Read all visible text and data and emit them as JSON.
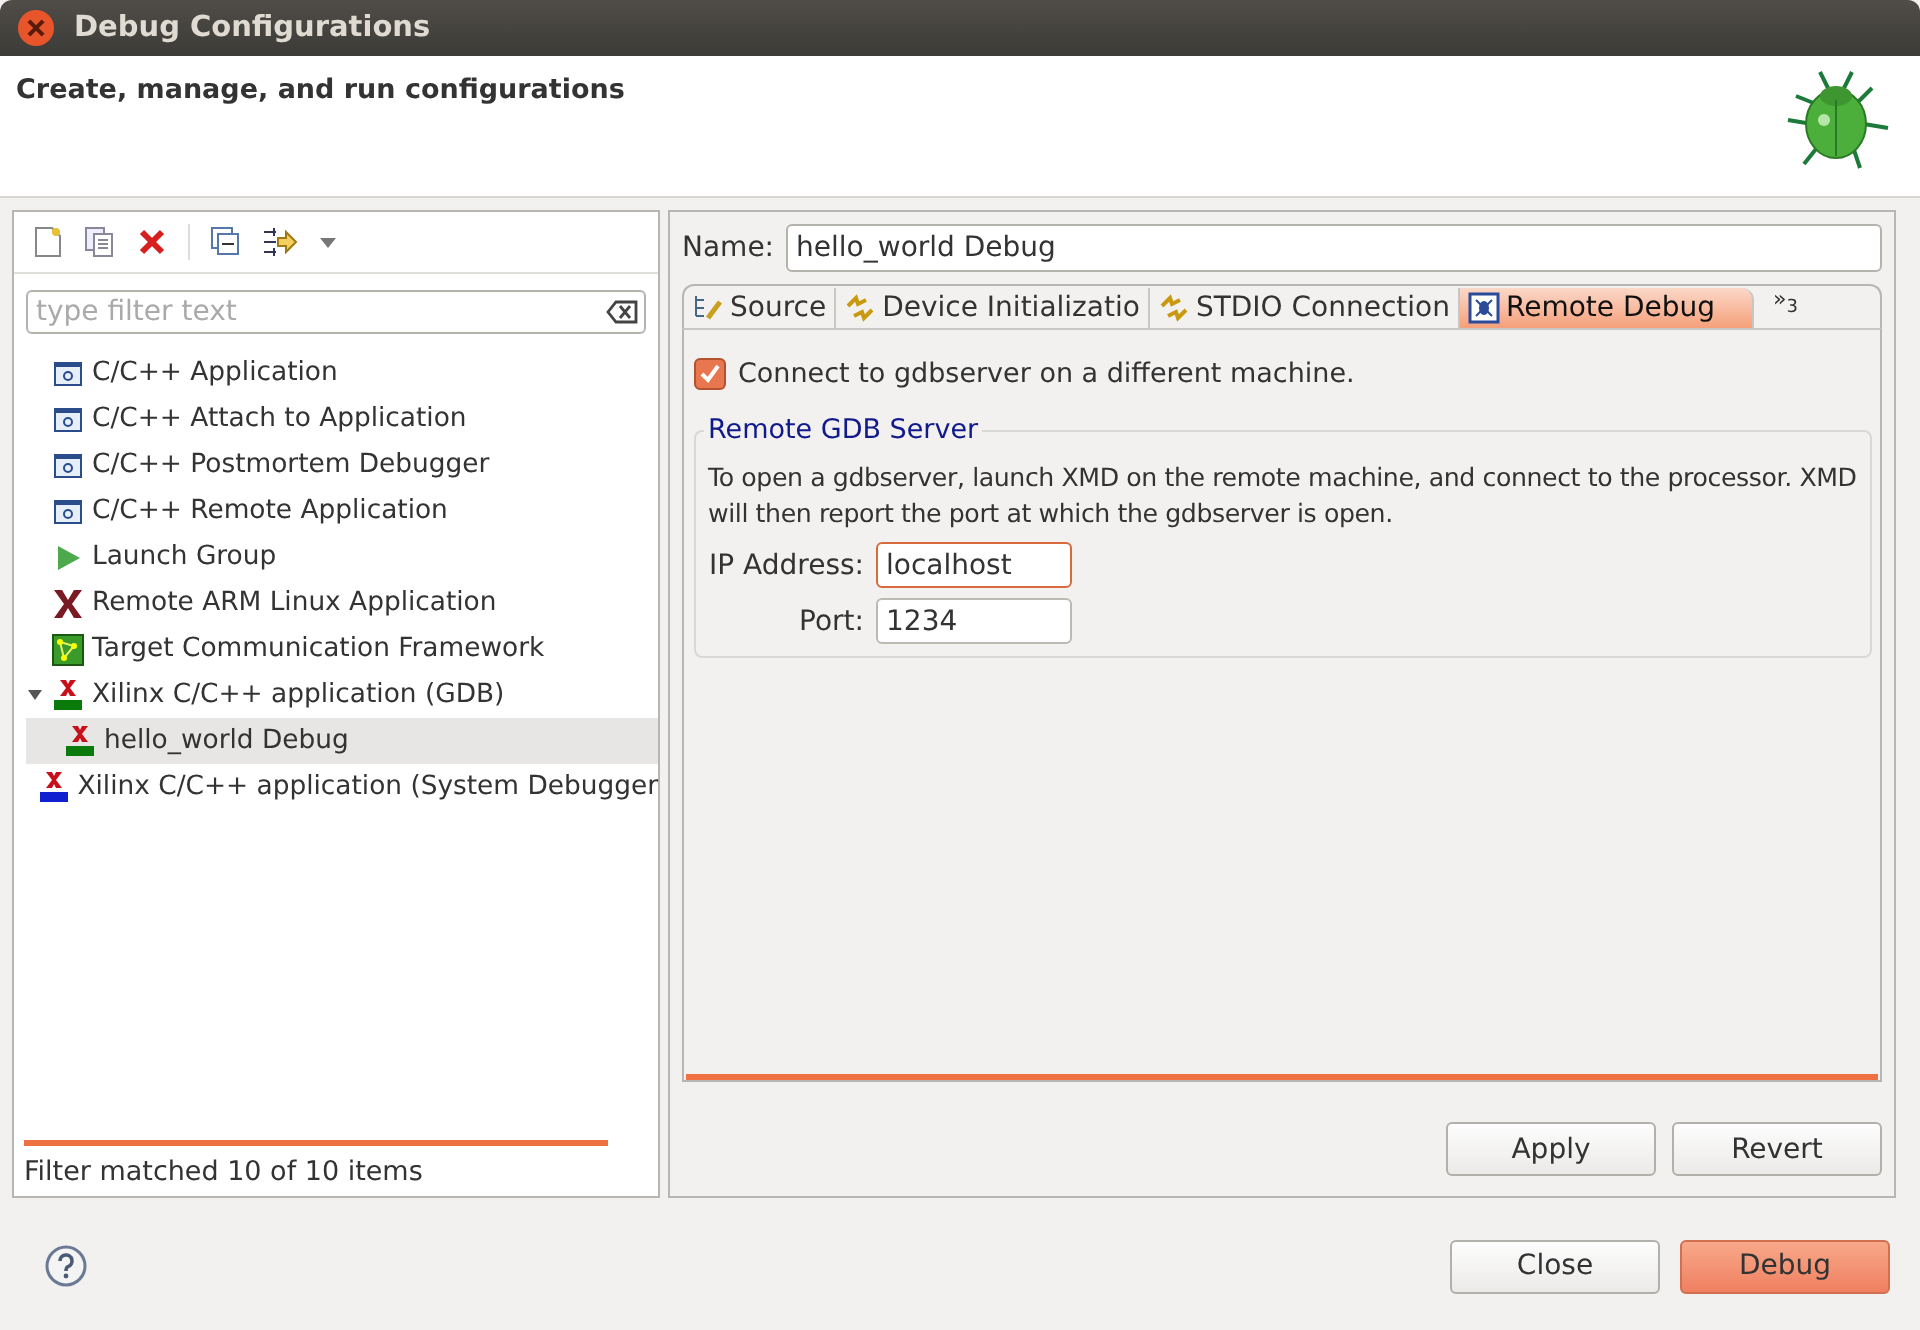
{
  "window": {
    "title": "Debug Configurations"
  },
  "header": {
    "title": "Create, manage, and run configurations"
  },
  "filter": {
    "placeholder": "type filter text"
  },
  "tree": [
    {
      "label": "C/C++ Application",
      "kind": "c-app",
      "selected": false
    },
    {
      "label": "C/C++ Attach to Application",
      "kind": "c-app",
      "selected": false
    },
    {
      "label": "C/C++ Postmortem Debugger",
      "kind": "c-app",
      "selected": false
    },
    {
      "label": "C/C++ Remote Application",
      "kind": "c-app",
      "selected": false
    },
    {
      "label": "Launch Group",
      "kind": "launch",
      "selected": false
    },
    {
      "label": "Remote ARM Linux Application",
      "kind": "xilinx",
      "selected": false
    },
    {
      "label": "Target Communication Framework",
      "kind": "tcf",
      "selected": false
    },
    {
      "label": "Xilinx C/C++ application (GDB)",
      "kind": "xilinx-gdb",
      "selected": false,
      "expanded": true,
      "children": [
        {
          "label": "hello_world Debug",
          "kind": "xilinx-gdb",
          "selected": true
        }
      ]
    },
    {
      "label": "Xilinx C/C++ application (System Debugger",
      "kind": "xilinx-tcf",
      "selected": false
    }
  ],
  "filter_status": "Filter matched 10 of 10 items",
  "name_field": {
    "label": "Name:",
    "value": "hello_world Debug"
  },
  "tabs": [
    {
      "label": "Source",
      "kind": "source",
      "selected": false
    },
    {
      "label": "Device Initializatio",
      "kind": "sync",
      "selected": false
    },
    {
      "label": "STDIO Connection",
      "kind": "sync",
      "selected": false
    },
    {
      "label": "Remote Debug",
      "kind": "remote",
      "selected": true
    }
  ],
  "tab_overflow": {
    "chevron": "»",
    "count": "3"
  },
  "remote": {
    "checkbox": {
      "label": "Connect to gdbserver on a different machine.",
      "checked": true
    },
    "group_title": "Remote GDB Server",
    "description": "To open a gdbserver, launch XMD on the remote machine, and connect to the processor. XMD will then report the port at which the gdbserver is open.",
    "ip": {
      "label": "IP Address:",
      "value": "localhost"
    },
    "port": {
      "label": "Port:",
      "value": "1234"
    }
  },
  "panel_buttons": [
    "Apply",
    "Revert"
  ],
  "dialog_buttons": [
    {
      "label": "Close",
      "kind": "normal"
    },
    {
      "label": "Debug",
      "kind": "default"
    }
  ]
}
